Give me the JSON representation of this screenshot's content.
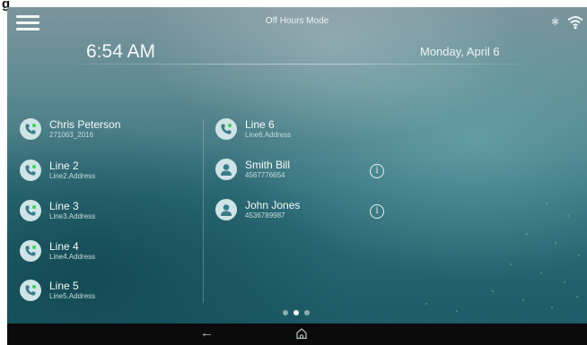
{
  "figure_label": "g",
  "header": {
    "mode": "Off Hours Mode",
    "time": "6:54 AM",
    "date": "Monday, April 6",
    "bluetooth_icon": "bluetooth-icon",
    "wifi_icon": "wifi-icon"
  },
  "left_column": [
    {
      "name": "Chris Peterson",
      "sub": "271063_2016",
      "icon": "phone-line-icon"
    },
    {
      "name": "Line 2",
      "sub": "Line2.Address",
      "icon": "phone-line-icon"
    },
    {
      "name": "Line 3",
      "sub": "Line3.Address",
      "icon": "phone-line-icon"
    },
    {
      "name": "Line 4",
      "sub": "Line4.Address",
      "icon": "phone-line-icon"
    },
    {
      "name": "Line 5",
      "sub": "Line5.Address",
      "icon": "phone-line-icon"
    }
  ],
  "right_column": [
    {
      "name": "Line 6",
      "sub": "Line6.Address",
      "icon": "phone-line-icon"
    },
    {
      "name": "Smith Bill",
      "sub": "4567776654",
      "icon": "contact-avatar-icon"
    },
    {
      "name": "John Jones",
      "sub": "4536789987",
      "icon": "contact-avatar-icon"
    }
  ],
  "pagination": {
    "pages": 3,
    "active_index": 1
  },
  "navbar": {
    "back_icon": "back-arrow-icon",
    "home_icon": "home-icon"
  },
  "colors": {
    "accent_green": "#3fcf5a",
    "icon_bg": "#cfe4e6",
    "navbar": "#0b0b0b"
  }
}
